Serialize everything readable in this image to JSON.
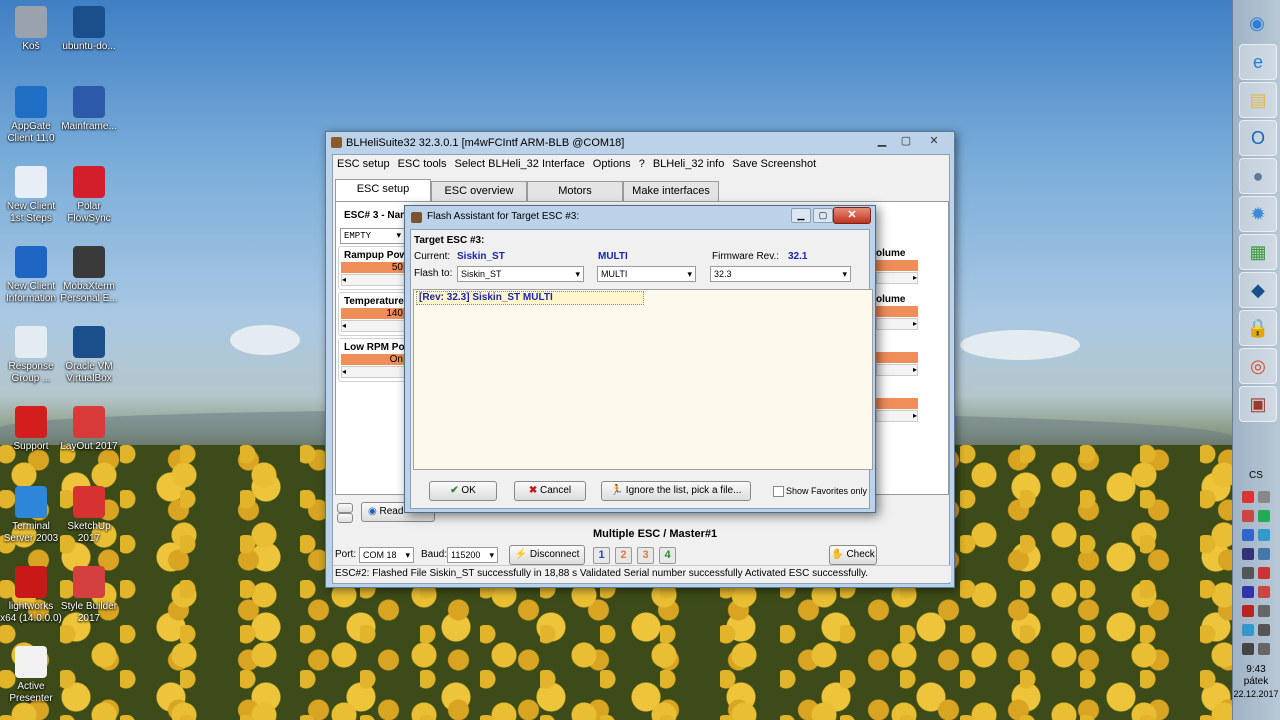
{
  "desktop": {
    "icons": [
      {
        "label": "Koš",
        "icon": "recycle-bin-icon",
        "color": "#9aa3ad"
      },
      {
        "label": "ubuntu-do...",
        "icon": "virtualbox-icon",
        "color": "#1b4f8c"
      },
      {
        "label": "AppGate Client 11.0",
        "icon": "appgate-icon",
        "color": "#1f6fc4"
      },
      {
        "label": "Mainframe...",
        "icon": "monitor-icon",
        "color": "#2c59a8"
      },
      {
        "label": "New Client 1st Steps",
        "icon": "checklist-icon",
        "color": "#e8eef5"
      },
      {
        "label": "Polar FlowSync",
        "icon": "polar-icon",
        "color": "#d21f2b"
      },
      {
        "label": "New Client Information",
        "icon": "info-icon",
        "color": "#1f66c2"
      },
      {
        "label": "MobaXterm Personal E...",
        "icon": "mobaxterm-icon",
        "color": "#3a3a3a"
      },
      {
        "label": "Response Group ...",
        "icon": "document-icon",
        "color": "#e4ecf3"
      },
      {
        "label": "Oracle VM VirtualBox",
        "icon": "virtualbox-icon",
        "color": "#1b4f8c"
      },
      {
        "label": "Support",
        "icon": "phone-support-icon",
        "color": "#d41e1e"
      },
      {
        "label": "LayOut 2017",
        "icon": "layout-icon",
        "color": "#d83a3a"
      },
      {
        "label": "Terminal Server 2003",
        "icon": "ie-icon",
        "color": "#2d86d8"
      },
      {
        "label": "SketchUp 2017",
        "icon": "sketchup-icon",
        "color": "#d63232"
      },
      {
        "label": "lightworks x64 (14.0.0.0)",
        "icon": "lightworks-icon",
        "color": "#c81818"
      },
      {
        "label": "Style Builder 2017",
        "icon": "stylebuilder-icon",
        "color": "#d44040"
      },
      {
        "label": "Active Presenter",
        "icon": "activepresenter-icon",
        "color": "#f2f2f2"
      }
    ]
  },
  "taskbar": {
    "buttons": [
      {
        "name": "start-orb-icon",
        "glyph": "◉",
        "color": "#2b7fd6"
      },
      {
        "name": "ie-icon",
        "glyph": "e",
        "color": "#1f7fd8"
      },
      {
        "name": "file-explorer-icon",
        "glyph": "▤",
        "color": "#e6b84a"
      },
      {
        "name": "outlook-icon",
        "glyph": "O",
        "color": "#1c64b8"
      },
      {
        "name": "app-round-icon",
        "glyph": "●",
        "color": "#5d7a9a"
      },
      {
        "name": "settings-globe-icon",
        "glyph": "✹",
        "color": "#3d8ad8"
      },
      {
        "name": "chart-app-icon",
        "glyph": "▦",
        "color": "#3a9a3a"
      },
      {
        "name": "virtualbox-icon",
        "glyph": "◆",
        "color": "#1b4f8c"
      },
      {
        "name": "lock-icon",
        "glyph": "🔒",
        "color": "#2a3c5a"
      },
      {
        "name": "chrome-icon",
        "glyph": "◎",
        "color": "#d84a2a"
      },
      {
        "name": "blheli-icon",
        "glyph": "▣",
        "color": "#9a3a2a"
      }
    ],
    "language": "CS",
    "time": "9:43",
    "day": "pátek",
    "date": "22.12.2017"
  },
  "main_window": {
    "title": "BLHeliSuite32 32.3.0.1  [m4wFCIntf ARM-BLB @COM18]",
    "menu": [
      "ESC setup",
      "ESC tools",
      "Select BLHeli_32 Interface",
      "Options",
      "?",
      "BLHeli_32 info",
      "Save Screenshot"
    ],
    "tabs": [
      "ESC setup",
      "ESC overview",
      "Motors",
      "Make interfaces"
    ],
    "esc_header": "ESC# 3 - Nar",
    "esc_name_value": "EMPTY",
    "rampup_label": "Rampup Pow",
    "rampup_value": "50",
    "temperature_label": "Temperature",
    "temperature_value": "140",
    "lowrpm_label": "Low RPM Po",
    "lowrpm_value": "On",
    "volume_label_1": "olume",
    "volume_label_2": "olume",
    "read_button": "Read",
    "multiple_esc": "Multiple ESC / Master#1",
    "port_label": "Port:",
    "port_value": "COM 18",
    "baud_label": "Baud:",
    "baud_value": "115200",
    "disconnect_button": "Disconnect",
    "esc_numbers": [
      "1",
      "2",
      "3",
      "4"
    ],
    "check_button": "Check",
    "status": "ESC#2: Flashed File  Siskin_ST successfully in 18,88 s    Validated Serial number successfully    Activated ESC successfully."
  },
  "dialog": {
    "title": "Flash Assistant for Target ESC #3:",
    "target": "Target ESC #3:",
    "current_label": "Current:",
    "current_value": "Siskin_ST",
    "mode_value": "MULTI",
    "firmware_label": "Firmware Rev.:",
    "firmware_value": "32.1",
    "flash_to_label": "Flash to:",
    "flash_to_value": "Siskin_ST",
    "flash_mode_value": "MULTI",
    "flash_rev_value": "32.3",
    "list_item": "[Rev: 32.3] Siskin_ST MULTI",
    "ok_button": "OK",
    "cancel_button": "Cancel",
    "ignore_button": "Ignore the list, pick a file...",
    "favorites_label": "Show Favorites only"
  }
}
